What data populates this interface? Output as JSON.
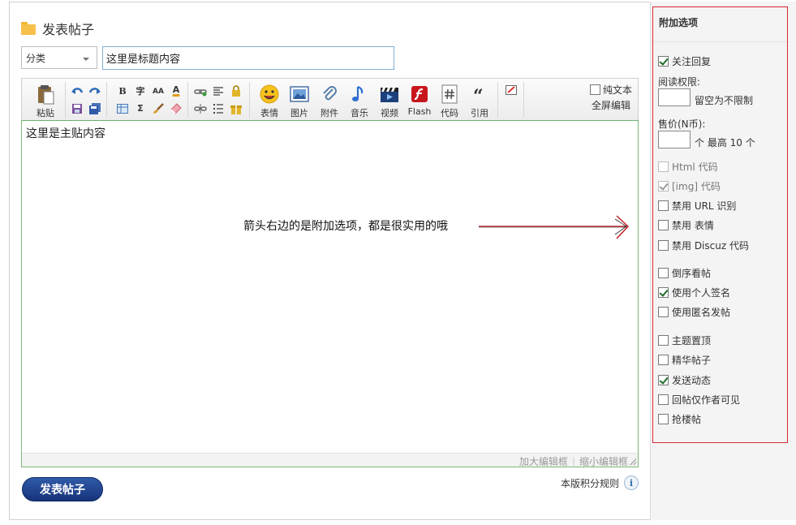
{
  "header": {
    "title": "发表帖子"
  },
  "form": {
    "category_value": "分类",
    "title_value": "这里是标题内容"
  },
  "toolbar": {
    "paste": "粘贴",
    "emoji": "表情",
    "image": "图片",
    "attach": "附件",
    "music": "音乐",
    "video": "视频",
    "flash": "Flash",
    "code": "代码",
    "quote": "引用",
    "bold": "B",
    "font": "字",
    "size": "AA",
    "color": "A",
    "sigma": "Σ",
    "plain_text": "纯文本",
    "fullscreen": "全屏编辑"
  },
  "editor": {
    "content": "这里是主贴内容",
    "annotation": "箭头右边的是附加选项，都是很实用的哦",
    "enlarge": "加大编辑框",
    "divider": "|",
    "shrink": "缩小编辑框"
  },
  "footer": {
    "submit": "发表帖子",
    "rules": "本版积分规则",
    "info_symbol": "i"
  },
  "sidebar": {
    "title": "附加选项",
    "subscribe": {
      "label": "关注回复",
      "checked": true
    },
    "read_perm_label": "阅读权限:",
    "read_perm_hint": "留空为不限制",
    "price_label": "售价(N币):",
    "price_unit": "个 最高 10 个",
    "options": [
      {
        "label": "Html 代码",
        "checked": false,
        "disabled": true
      },
      {
        "label": "[img] 代码",
        "checked": true,
        "disabled": true
      },
      {
        "label": "禁用 URL 识别",
        "checked": false,
        "disabled": false
      },
      {
        "label": "禁用 表情",
        "checked": false,
        "disabled": false
      },
      {
        "label": "禁用 Discuz 代码",
        "checked": false,
        "disabled": false
      },
      {
        "label": "倒序看帖",
        "checked": false,
        "disabled": false
      },
      {
        "label": "使用个人签名",
        "checked": true,
        "disabled": false
      },
      {
        "label": "使用匿名发帖",
        "checked": false,
        "disabled": false
      },
      {
        "label": "主题置顶",
        "checked": false,
        "disabled": false
      },
      {
        "label": "精华帖子",
        "checked": false,
        "disabled": false
      },
      {
        "label": "发送动态",
        "checked": true,
        "disabled": false
      },
      {
        "label": "回帖仅作者可见",
        "checked": false,
        "disabled": false
      },
      {
        "label": "抢楼帖",
        "checked": false,
        "disabled": false
      }
    ]
  },
  "colors": {
    "sidebar_border": "#d8282e",
    "editor_border": "#7cb87c",
    "submit_bg": "#1f3f8c",
    "arrow": "#c0262c"
  }
}
